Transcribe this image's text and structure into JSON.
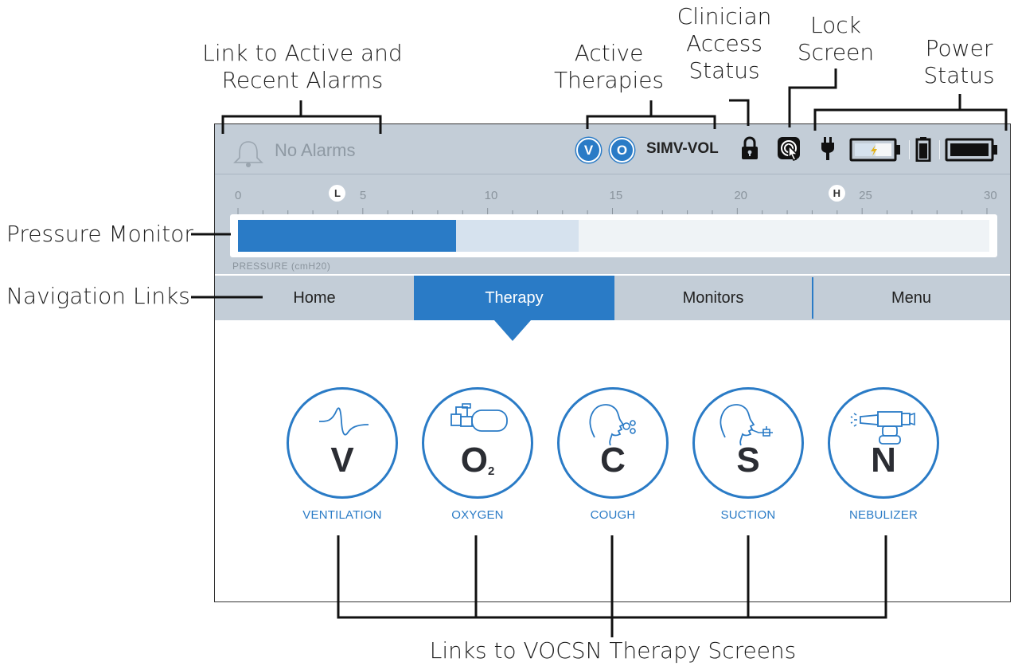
{
  "callouts": {
    "alarms": [
      "Link to Active and",
      "Recent Alarms"
    ],
    "therapies": [
      "Active",
      "Therapies"
    ],
    "clinician": [
      "Clinician",
      "Access",
      "Status"
    ],
    "lock": [
      "Lock",
      "Screen"
    ],
    "power": [
      "Power",
      "Status"
    ],
    "pressure": "Pressure Monitor",
    "navigation": "Navigation Links",
    "vocsn": "Links to VOCSN Therapy Screens"
  },
  "status": {
    "alarm_text": "No Alarms",
    "active_therapies": [
      "V",
      "O"
    ],
    "mode": "SIMV-VOL"
  },
  "pressure": {
    "label": "PRESSURE (cmH20)",
    "ticks": [
      "0",
      "5",
      "10",
      "15",
      "20",
      "25",
      "30"
    ],
    "low_marker": "L",
    "high_marker": "H",
    "low_value": 4,
    "high_value": 24,
    "current_value": 8.7,
    "range_end": 13.6
  },
  "nav": {
    "home": "Home",
    "therapy": "Therapy",
    "monitors": "Monitors",
    "menu": "Menu"
  },
  "therapies": [
    {
      "letter": "V",
      "label": "VENTILATION"
    },
    {
      "letter": "O",
      "sub": "2",
      "label": "OXYGEN"
    },
    {
      "letter": "C",
      "label": "COUGH"
    },
    {
      "letter": "S",
      "label": "SUCTION"
    },
    {
      "letter": "N",
      "label": "NEBULIZER"
    }
  ],
  "colors": {
    "accent": "#2a7bc6",
    "status_bar": "#c3cdd7",
    "bar_track": "#eff3f6",
    "bar_range": "#d6e2ee"
  },
  "icons": [
    "bell-icon",
    "lock-icon",
    "touch-lock-icon",
    "plug-icon",
    "battery-charging-icon",
    "battery-vertical-icon",
    "battery-full-icon"
  ]
}
